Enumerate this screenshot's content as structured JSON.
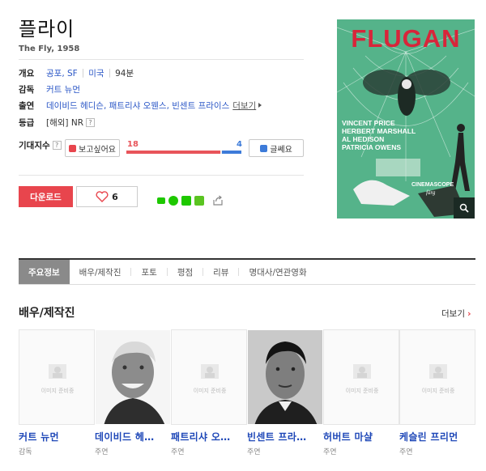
{
  "movie": {
    "title": "플라이",
    "original_title": "The Fly, 1958"
  },
  "info": {
    "genre_label": "개요",
    "genre": "공포, SF",
    "country": "미국",
    "runtime": "94분",
    "director_label": "감독",
    "director": "커트 뉴먼",
    "cast_label": "출연",
    "cast_names": "데이비드 헤디슨, 패트리샤 오웬스, 빈센트 프라이스",
    "cast_more": "더보기",
    "rating_label": "등급",
    "rating": "[해외] NR",
    "rating_help": "?"
  },
  "expectation": {
    "label": "기대지수",
    "help": "?",
    "want_label": "보고싶어요",
    "dont_label": "글쎄요",
    "want_count": "18",
    "dont_count": "4",
    "want_fraction": 0.818
  },
  "actions": {
    "download_label": "다운로드",
    "like_count": "6"
  },
  "poster": {
    "title_text": "FLUGAN",
    "credits": [
      "VINCENT PRICE",
      "HERBERT MARSHALL",
      "AL HEDISON",
      "PATRICIA OWENS"
    ],
    "format": "CINEMASCOPE",
    "format_sub": "färg",
    "colors": {
      "background": "#55b38a",
      "title": "#d8253a",
      "credits": "#ffffff"
    }
  },
  "tabs": [
    {
      "label": "주요정보",
      "active": true
    },
    {
      "label": "배우/제작진",
      "active": false
    },
    {
      "label": "포토",
      "active": false
    },
    {
      "label": "평점",
      "active": false
    },
    {
      "label": "리뷰",
      "active": false
    },
    {
      "label": "명대사/연관영화",
      "active": false
    }
  ],
  "cast_section": {
    "title": "배우/제작진",
    "more_label": "더보기",
    "noimg_text": "이미지 준비중",
    "people": [
      {
        "name": "커트 뉴먼",
        "role": "감독",
        "has_photo": false
      },
      {
        "name": "데이비드 헤…",
        "role": "주연",
        "has_photo": true
      },
      {
        "name": "패트리샤 오…",
        "role": "주연",
        "has_photo": false
      },
      {
        "name": "빈센트 프라…",
        "role": "주연",
        "has_photo": true
      },
      {
        "name": "허버트 마샬",
        "role": "주연",
        "has_photo": false
      },
      {
        "name": "케슬린 프리먼",
        "role": "주연",
        "has_photo": false
      }
    ]
  },
  "colors": {
    "accent_red": "#e8454d",
    "link_blue": "#2a56c6",
    "like_blue": "#3d7bd9",
    "share_green": "#1ec800"
  }
}
